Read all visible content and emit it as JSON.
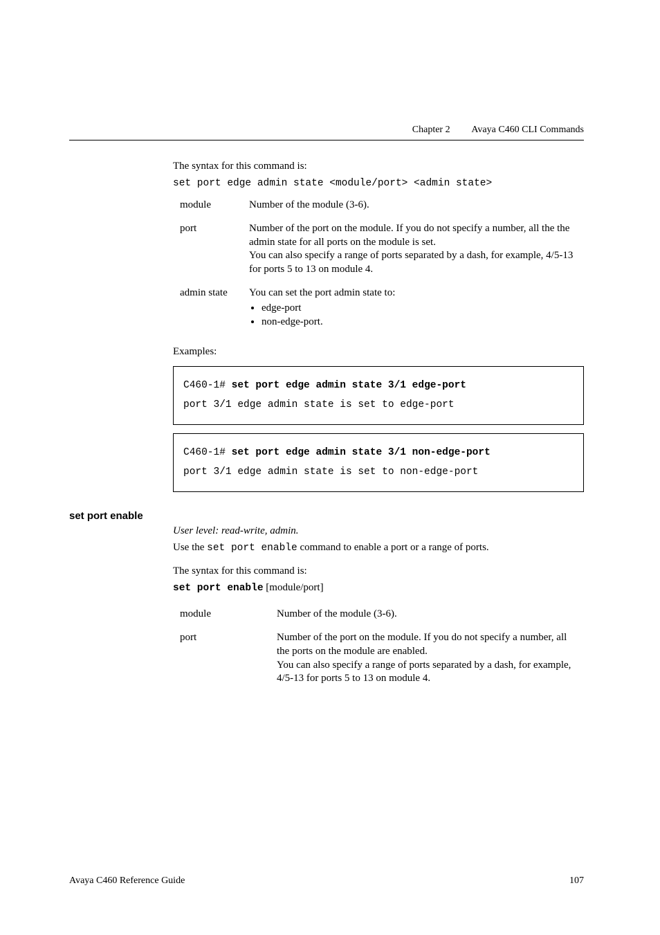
{
  "header": {
    "chapter": "Chapter 2",
    "title": "Avaya C460 CLI Commands"
  },
  "section1": {
    "syntax_intro": "The syntax for this command is:",
    "syntax_line": "set port edge admin state <module/port> <admin state>",
    "params": {
      "module_key": "module",
      "module_desc": "Number of the module (3-6).",
      "port_key": "port",
      "port_desc": "Number of the port on the module. If you do not specify a number, all the the admin state for all ports on the module is set.\nYou can also specify a range of ports separated by a dash, for example, 4/5-13 for ports 5 to 13 on module 4.",
      "admin_key": "admin state",
      "admin_desc_line": "You can set the port admin state to:",
      "admin_bullets": [
        "edge-port",
        "non-edge-port."
      ]
    },
    "examples_label": "Examples:",
    "ex1_prompt": "C460-1# ",
    "ex1_cmd": "set port edge admin state 3/1 edge-port",
    "ex1_out": "port 3/1 edge admin state is set to edge-port",
    "ex2_prompt": "C460-1# ",
    "ex2_cmd": "set port edge admin state 3/1 non-edge-port",
    "ex2_out": "port 3/1 edge admin state is set to non-edge-port"
  },
  "section2": {
    "heading": "set port enable",
    "user_level": "User level: read-write, admin.",
    "use_pre": "Use the ",
    "use_code": "set port enable",
    "use_post": " command to enable a port or a range of ports.",
    "syntax_intro": "The syntax for this command is:",
    "syntax_bold": "set port enable",
    "syntax_rest": " [module/port]",
    "params": {
      "module_key": "module",
      "module_desc": "Number of the module (3-6).",
      "port_key": "port",
      "port_desc": "Number of the port on the module. If you do not specify a number, all the ports on the module are enabled.\nYou can also specify a range of ports separated by a dash, for example, 4/5-13 for ports 5 to 13 on module 4."
    }
  },
  "footer": {
    "left": "Avaya C460 Reference Guide",
    "right": "107"
  }
}
